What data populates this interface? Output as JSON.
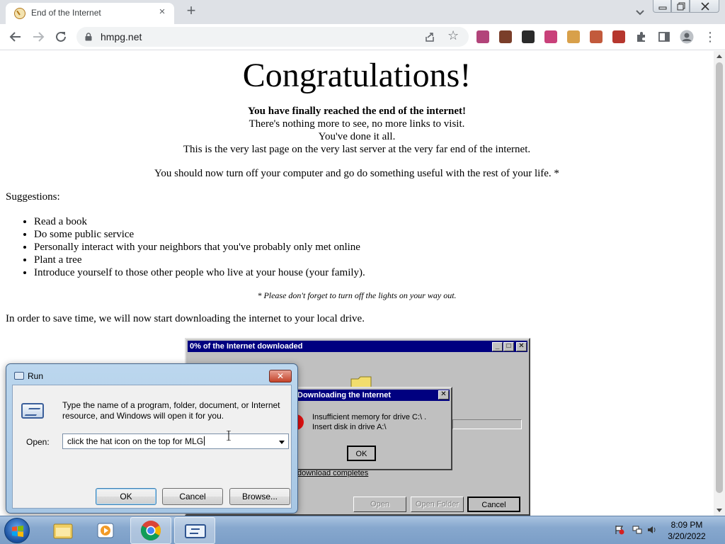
{
  "browser": {
    "tab_title": "End of the Internet",
    "tab_close": "×",
    "new_tab": "+",
    "url": "hmpg.net",
    "extension_colors": [
      "#b2447a",
      "#7a3e2a",
      "#2b2b2b",
      "#c9417a",
      "#d8a04a",
      "#c25a3c",
      "#b6372e"
    ]
  },
  "page": {
    "heading": "Congratulations!",
    "bold_line": "You have finally reached the end of the internet!",
    "line2": "There's nothing more to see, no more links to visit.",
    "line3": "You've done it all.",
    "line4": "This is the very last page on the very last server at the very far end of the internet.",
    "turn_off": "You should now turn off your computer and go do something useful with the rest of your life. *",
    "suggestions_label": "Suggestions:",
    "suggestions": [
      "Read a book",
      "Do some public service",
      "Personally interact with your neighbors that you've probably only met online",
      "Plant a tree",
      "Introduce yourself to those other people who live at your house (your family)."
    ],
    "footnote": "* Please don't forget to turn off the lights on your way out.",
    "save_time": "In order to save time, we will now start downloading the internet to your local drive."
  },
  "download_window": {
    "title": "0% of the Internet downloaded",
    "status_fragment": "download completes",
    "open_label": "Open",
    "open_folder_label": "Open Folder",
    "cancel_label": "Cancel",
    "min_glyph": "_",
    "max_glyph": "□",
    "close_glyph": "✕"
  },
  "error_dialog": {
    "title": "Downloading the Internet",
    "message_line1": "Insufficient memory for drive C:\\ .",
    "message_line2": "Insert disk in drive A:\\",
    "ok_label": "OK",
    "close_glyph": "✕"
  },
  "run_dialog": {
    "title": "Run",
    "description": "Type the name of a program, folder, document, or Internet resource, and Windows will open it for you.",
    "open_label": "Open:",
    "input_value": "click the hat icon on the top for MLG",
    "ok_label": "OK",
    "cancel_label": "Cancel",
    "browse_label": "Browse...",
    "close_glyph": "✕"
  },
  "taskbar": {
    "time": "8:09 PM",
    "date": "3/20/2022"
  }
}
